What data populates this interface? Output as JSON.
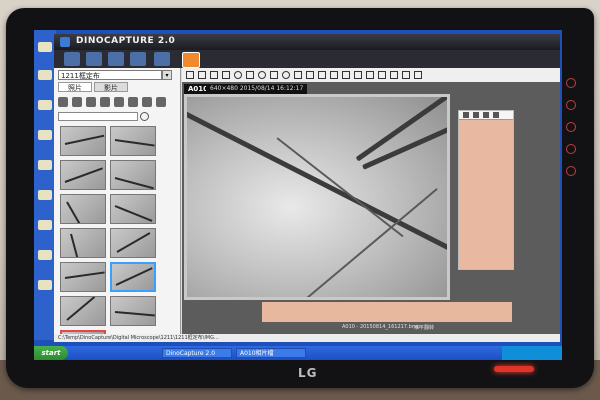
{
  "app": {
    "title": "DINOCAPTURE 2.0"
  },
  "left_panel": {
    "project": "1211框定布",
    "tabs": [
      "照片",
      "影片"
    ],
    "thumbnail_count": 13
  },
  "viewer": {
    "capture_id": "A010",
    "capture_meta": "640×480  2015/08/14  16:12:17",
    "bottom_filename": "A010 - 20150814_161217.bmp",
    "bottom_note": "水平翻转"
  },
  "status_bar": {
    "path": "C:\\Temp\\DinoCapture\\Digital Microscope\\1211\\1211框定布\\IMG…"
  },
  "taskbar": {
    "start_label": "start",
    "items": [
      "DinoCapture 2.0",
      "A010相片檔"
    ]
  },
  "monitor": {
    "brand": "LG"
  },
  "colors": {
    "accent_orange": "#f08a2e",
    "selection_blue": "#3aa0ff",
    "desktop_blue": "#1f4fb8"
  }
}
